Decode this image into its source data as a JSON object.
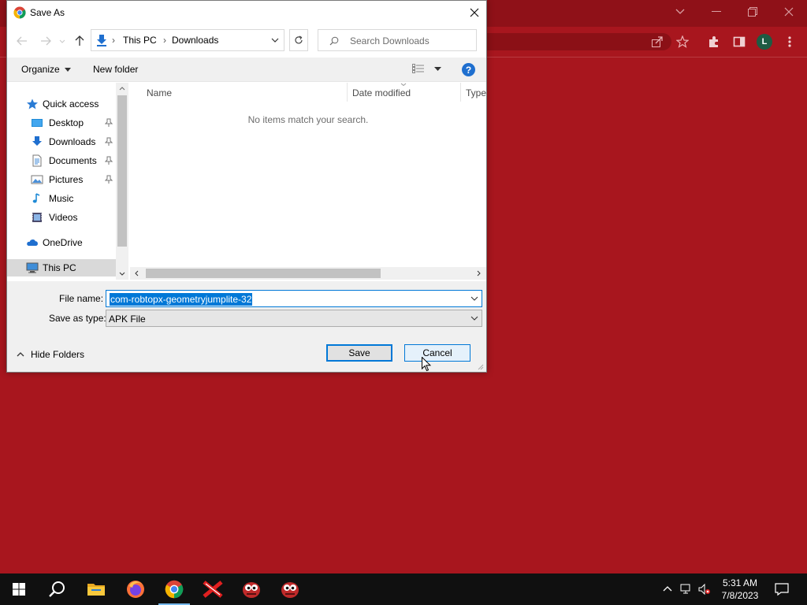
{
  "dialog": {
    "title": "Save As",
    "breadcrumb": [
      "This PC",
      "Downloads"
    ],
    "search_placeholder": "Search Downloads",
    "organize_label": "Organize",
    "new_folder_label": "New folder",
    "help_label": "?",
    "nav_tree": [
      {
        "label": "Quick access",
        "icon": "star-icon"
      },
      {
        "label": "Desktop",
        "icon": "desktop-icon",
        "pinned": true
      },
      {
        "label": "Downloads",
        "icon": "download-icon",
        "pinned": true
      },
      {
        "label": "Documents",
        "icon": "documents-icon",
        "pinned": true
      },
      {
        "label": "Pictures",
        "icon": "pictures-icon",
        "pinned": true
      },
      {
        "label": "Music",
        "icon": "music-icon"
      },
      {
        "label": "Videos",
        "icon": "videos-icon"
      },
      {
        "label": "OneDrive",
        "icon": "cloud-icon"
      },
      {
        "label": "This PC",
        "icon": "computer-icon",
        "selected": true
      }
    ],
    "columns": [
      "Name",
      "Date modified",
      "Type"
    ],
    "empty_message": "No items match your search.",
    "file_name_label": "File name:",
    "file_name_value": "com-robtopx-geometryjumplite-32",
    "save_type_label": "Save as type:",
    "save_type_value": "APK File",
    "save_label": "Save",
    "cancel_label": "Cancel",
    "hide_folders_label": "Hide Folders"
  },
  "browser": {
    "avatar_letter": "L",
    "background_color": "#a8161e"
  },
  "taskbar": {
    "time": "5:31 AM",
    "date": "7/8/2023",
    "apps": [
      "start-icon",
      "search-icon",
      "file-explorer-icon",
      "firefox-icon",
      "chrome-icon",
      "app-x-icon",
      "game-icon",
      "game-icon-2"
    ]
  }
}
